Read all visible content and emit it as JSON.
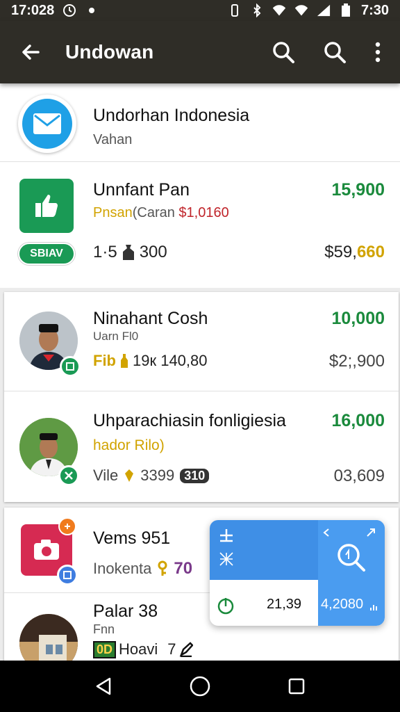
{
  "status_bar": {
    "time_left": "17:028",
    "time_right": "7:30"
  },
  "app_bar": {
    "title": "Undowan"
  },
  "rows": {
    "r1": {
      "name": "Undorhan Indonesia",
      "sub": "Vahan"
    },
    "r2": {
      "name": "Unnfant Pan",
      "sub_yellow": "Pnsan",
      "sub_gray": "(Caran ",
      "sub_red": "$1,0160",
      "amount": "15,900",
      "badge": "SBIAV",
      "meta": "1·5",
      "meta2": "300",
      "right_amount_a": "$59,",
      "right_amount_b": "660"
    },
    "r3": {
      "name": "Ninahant Cosh",
      "sub": "Uarn Fl0",
      "meta_yellow": "Fib",
      "meta": "19к 140,80",
      "amount": "10,000",
      "right_amount": "$2;,900"
    },
    "r4": {
      "name": "Uhparachiasin fonligiesia",
      "sub": "hador Rilo)",
      "meta": "Vile",
      "meta2": "3399",
      "meta_badge": "310",
      "amount": "16,000",
      "right_amount": "03,609"
    },
    "r5": {
      "name": "Vems 951",
      "sub": "Inokenta",
      "sub_amount": "70"
    },
    "r6": {
      "name": "Palar 38",
      "sub": "Fnn",
      "meta_badge": "0D",
      "meta": "Hoavi",
      "meta2": "7"
    }
  },
  "float_panel": {
    "amount_dark": "21,39",
    "amount_light": "4,2080"
  },
  "colors": {
    "app_bar": "#2f2d27",
    "green": "#1a8a3c",
    "accent_blue": "#3f8fe6",
    "yellow": "#d1a300",
    "red": "#c0242a"
  }
}
